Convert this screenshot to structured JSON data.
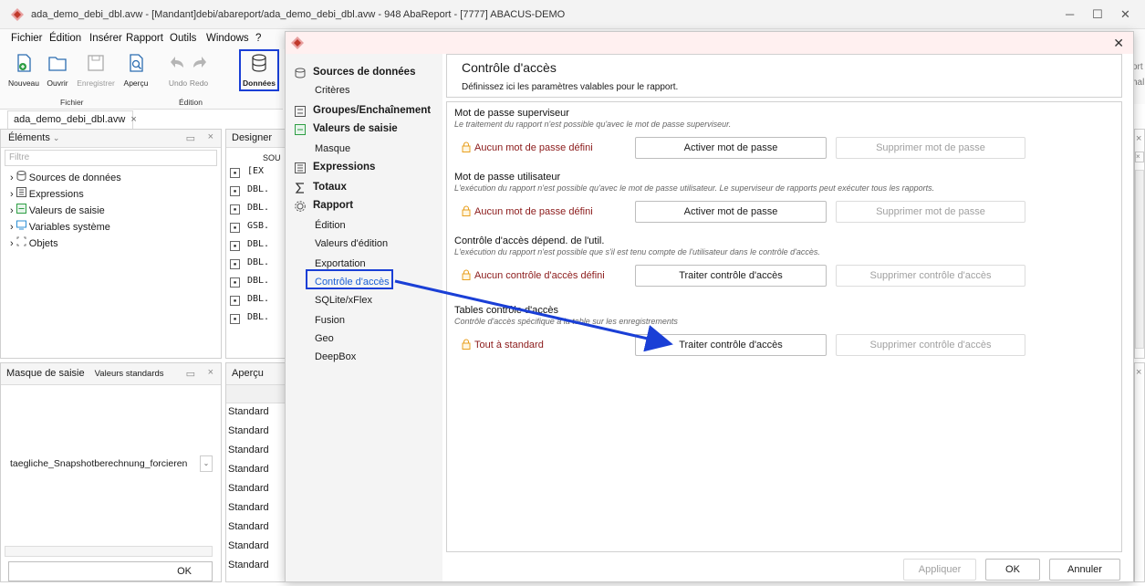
{
  "window": {
    "title": "ada_demo_debi_dbl.avw - [Mandant]debi/abareport/ada_demo_debi_dbl.avw - 948 AbaReport - [7777] ABACUS-DEMO",
    "buttons": {
      "minimize": "─",
      "maximize": "☐",
      "close": "✕"
    }
  },
  "menu": [
    "Fichier",
    "Édition",
    "Insérer",
    "Rapport",
    "Outils",
    "Windows",
    "?"
  ],
  "ribbon": {
    "buttons": [
      "Nouveau",
      "Ouvrir",
      "Enregistrer",
      "Aperçu",
      "Undo",
      "Redo",
      "Données"
    ],
    "groups": [
      "Fichier",
      "Édition"
    ]
  },
  "document_tab": "ada_demo_debi_dbl.avw",
  "elements_panel": {
    "title": "Éléments",
    "filter_placeholder": "Filtre",
    "items": [
      "Sources de données",
      "Expressions",
      "Valeurs de saisie",
      "Variables système",
      "Objets"
    ]
  },
  "designer_panel": {
    "title": "Designer",
    "header": "SOU",
    "rows": [
      "[EX",
      "DBL.",
      "DBL.",
      "GSB.",
      "DBL.",
      "DBL.",
      "DBL.",
      "DBL.",
      "DBL."
    ]
  },
  "masque_panel": {
    "tabs": [
      "Masque de saisie",
      "Valeurs standards"
    ],
    "field_value": "taegliche_Snapshotberechnung_forcieren",
    "ok_label": "OK"
  },
  "apercu_panel": {
    "title": "Aperçu",
    "rows": [
      "Standard",
      "Standard",
      "Standard",
      "Standard",
      "Standard",
      "Standard",
      "Standard",
      "Standard",
      "Standard"
    ]
  },
  "right_edge": {
    "line1": "ort",
    "line2": "hal"
  },
  "dialog": {
    "nav": [
      {
        "label": "Sources de données",
        "header": true,
        "icon": "database-icon"
      },
      {
        "label": "Critères",
        "header": false
      },
      {
        "label": "Groupes/Enchaînement",
        "header": true,
        "icon": "groups-icon"
      },
      {
        "label": "Valeurs de saisie",
        "header": true,
        "icon": "input-values-icon"
      },
      {
        "label": "Masque",
        "header": false
      },
      {
        "label": "Expressions",
        "header": true,
        "icon": "expressions-icon"
      },
      {
        "label": "Totaux",
        "header": true,
        "icon": "sigma-icon"
      },
      {
        "label": "Rapport",
        "header": true,
        "icon": "gear-icon"
      },
      {
        "label": "Édition",
        "header": false
      },
      {
        "label": "Valeurs d'édition",
        "header": false
      },
      {
        "label": "Exportation",
        "header": false
      },
      {
        "label": "Contrôle d'accès",
        "header": false,
        "selected": true
      },
      {
        "label": "SQLite/xFlex",
        "header": false
      },
      {
        "label": "Fusion",
        "header": false
      },
      {
        "label": "Geo",
        "header": false
      },
      {
        "label": "DeepBox",
        "header": false
      }
    ],
    "title": "Contrôle d'accès",
    "subtitle": "Définissez ici les paramètres valables pour le rapport.",
    "sections": [
      {
        "title": "Mot de passe superviseur",
        "description": "Le traitement du rapport n'est possible qu'avec le mot de passe superviseur.",
        "status": "Aucun mot de passe défini",
        "action": "Activer mot de passe",
        "remove": "Supprimer mot de passe"
      },
      {
        "title": "Mot de passe utilisateur",
        "description": "L'exécution du rapport n'est possible qu'avec le mot de passe utilisateur. Le superviseur de rapports peut exécuter tous les rapports.",
        "status": "Aucun mot de passe défini",
        "action": "Activer mot de passe",
        "remove": "Supprimer mot de passe"
      },
      {
        "title": "Contrôle d'accès dépend. de l'util.",
        "description": "L'exécution du rapport n'est possible que s'il est tenu compte de l'utilisateur dans le contrôle d'accès.",
        "status": "Aucun contrôle d'accès défini",
        "action": "Traiter contrôle d'accès",
        "remove": "Supprimer contrôle d'accès"
      },
      {
        "title": "Tables contrôle d'accès",
        "description": "Contrôle d'accès spécifique à la table sur les enregistrements",
        "status": "Tout à standard",
        "action": "Traiter contrôle d'accès",
        "remove": "Supprimer contrôle d'accès"
      }
    ],
    "footer": {
      "apply": "Appliquer",
      "ok": "OK",
      "cancel": "Annuler"
    }
  },
  "colors": {
    "highlight": "#1a3fd6",
    "warning": "#8b1a1a",
    "lock": "#e8a020",
    "title_bg": "#fff0f0"
  }
}
